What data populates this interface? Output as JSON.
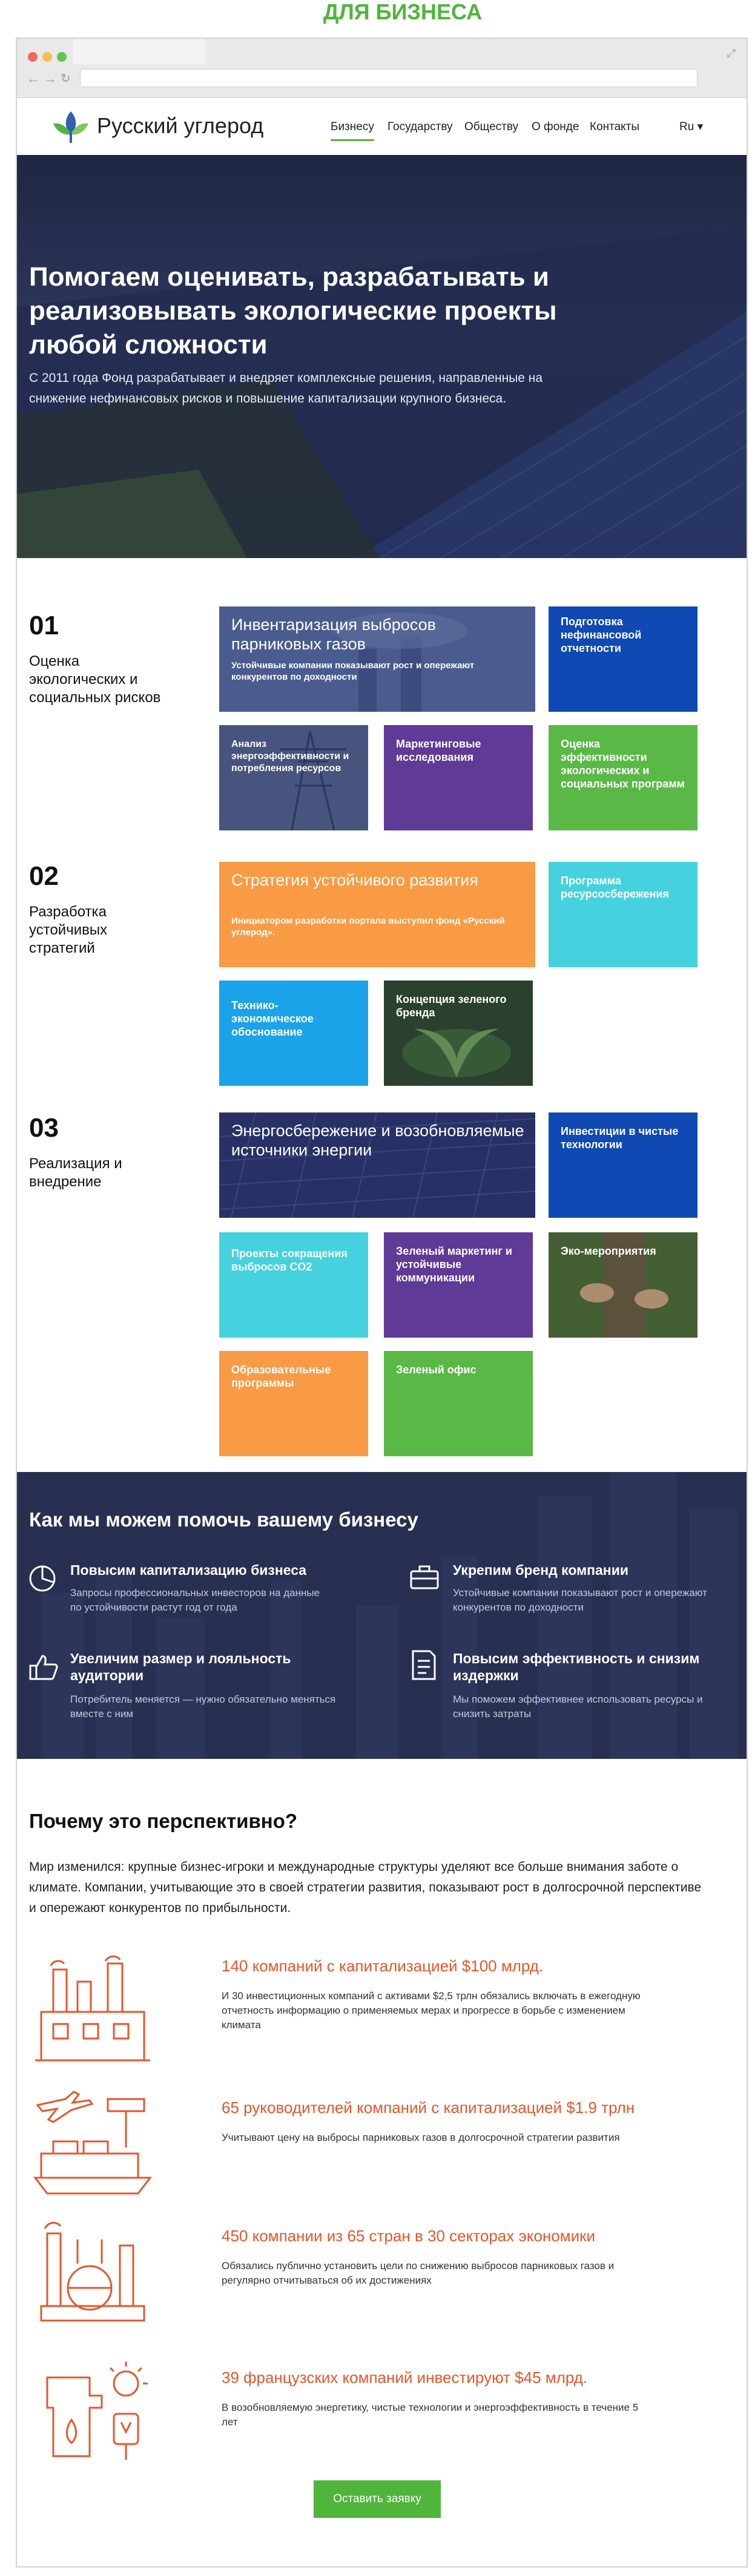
{
  "banner_label": "ДЛЯ БИЗНЕСА",
  "site": {
    "logo_text": "Русский углерод"
  },
  "nav": {
    "items": [
      "Бизнесу",
      "Государству",
      "Обществу",
      "О фонде",
      "Контакты"
    ],
    "lang": "Ru ▾"
  },
  "hero": {
    "title": "Помогаем оценивать, разрабатывать и реализовывать экологические проекты любой сложности",
    "text": "С 2011 года Фонд разрабатывает и внедряет комплексные решения, направленные на снижение нефинансовых рисков и повышение капитализации крупного бизнеса."
  },
  "steps": [
    {
      "num": "01",
      "title": "Оценка экологических и социальных рисков",
      "cards": [
        {
          "title": "Инвентаризация выбросов парниковых газов",
          "sub": "Устойчивые компании показывают рост и опережают конкурентов по доходности"
        },
        {
          "title": "Подготовка нефинансовой отчетности"
        },
        {
          "title": "Анализ энергоэффективности и потребления ресурсов"
        },
        {
          "title": "Маркетинговые исследования"
        },
        {
          "title": "Оценка эффективности экологических и социальных программ"
        }
      ]
    },
    {
      "num": "02",
      "title": "Разработка устойчивых стратегий",
      "cards": [
        {
          "title": "Стратегия устойчивого развития",
          "sub": "Инициатором разработки портала выступил фонд «Русский углерод»."
        },
        {
          "title": "Программа ресурсосбережения"
        },
        {
          "title": "Технико-экономическое обоснование"
        },
        {
          "title": "Концепция зеленого бренда"
        }
      ]
    },
    {
      "num": "03",
      "title": "Реализация и внедрение",
      "cards": [
        {
          "title": "Энергосбережение и возобновляемые источники энергии"
        },
        {
          "title": "Инвестиции в чистые технологии"
        },
        {
          "title": "Проекты сокращения выбросов CO2"
        },
        {
          "title": "Зеленый маркетинг и устойчивые коммуникации"
        },
        {
          "title": "Эко-мероприятия"
        },
        {
          "title": "Образовательные программы"
        },
        {
          "title": "Зеленый офис"
        }
      ]
    }
  ],
  "help": {
    "heading": "Как мы можем помочь вашему бизнесу",
    "items": [
      {
        "icon": "pie-chart-icon",
        "title": "Повысим капитализацию бизнеса",
        "text": "Запросы профессиональных инвесторов на данные по устойчивости растут год от года"
      },
      {
        "icon": "briefcase-icon",
        "title": "Укрепим бренд компании",
        "text": "Устойчивые компании показывают рост и опережают конкурентов по доходности"
      },
      {
        "icon": "thumbs-up-icon",
        "title": "Увеличим размер и лояльность аудитории",
        "text": "Потребитель меняется — нужно обязательно меняться вместе с ним"
      },
      {
        "icon": "document-icon",
        "title": "Повысим эффективность и снизим издержки",
        "text": "Мы поможем эффективнее использовать ресурсы и снизить затраты"
      }
    ]
  },
  "why": {
    "heading": "Почему это перспективно?",
    "text": "Мир изменился: крупные бизнес-игроки и международные структуры уделяют все больше внимания заботе о климате. Компании, учитывающие это в своей стратегии развития, показывают рост в долгосрочной перспективе и опережают конкурентов по прибыльности.",
    "stats": [
      {
        "icon": "factory-icon",
        "title": "140 компаний с капитализацией $100 млрд.",
        "text": "И 30 инвестиционных компаний с активами $2,5 трлн обязались включать в ежегодную отчетность информацию о применяемых мерах и прогрессе в борьбе с изменением климата"
      },
      {
        "icon": "logistics-icon",
        "title": "65 руководителей компаний с капитализацией $1.9 трлн",
        "text": "Учитывают цену на выбросы парниковых газов в долгосрочной стратегии развития"
      },
      {
        "icon": "industry-icon",
        "title": "450 компании из 65 стран в 30 секторах экономики",
        "text": "Обязались публично установить цели по снижению выбросов парниковых газов и регулярно отчитываться об их достижениях"
      },
      {
        "icon": "clean-energy-icon",
        "title": "39 французских компаний инвестируют $45 млрд.",
        "text": "В возобновляемую энергетику, чистые технологии и энергоэффективность в течение 5 лет"
      }
    ]
  },
  "cta": {
    "label": "Оставить заявку"
  },
  "colors": {
    "accent": "#4fb53b",
    "blue": "#1049b3",
    "purple": "#5f3a97",
    "orange": "#f99b45",
    "cyan": "#45d2de",
    "green": "#5ab847",
    "stat": "#e8552a"
  }
}
